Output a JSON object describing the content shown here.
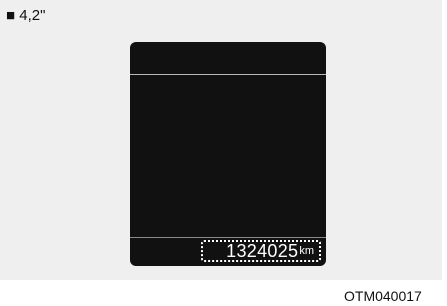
{
  "caption": "■ 4,2\"",
  "odometer": {
    "value": "1324025",
    "unit": "km"
  },
  "figure_code": "OTM040017",
  "colors": {
    "background": "#efefef",
    "screen": "#111111",
    "text_on_screen": "#ffffff"
  }
}
